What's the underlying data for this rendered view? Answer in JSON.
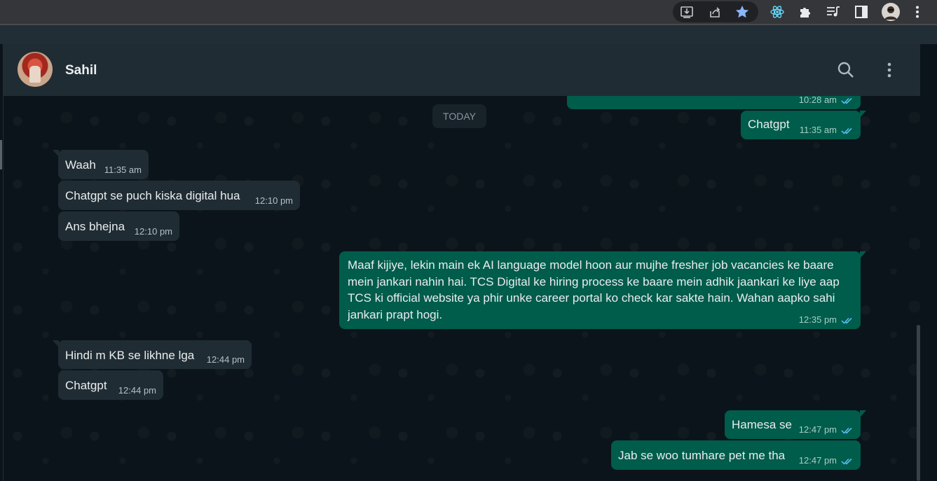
{
  "browser": {
    "icons": [
      "install-app-icon",
      "share-icon",
      "star-bookmark-icon",
      "react-devtools-icon",
      "extensions-puzzle-icon",
      "media-controls-icon",
      "side-panel-icon",
      "profile-avatar",
      "browser-menu-icon"
    ],
    "bookmark_star_color": "#8ab4f8"
  },
  "chat": {
    "contact_name": "Sahil",
    "header_icons": [
      "search-icon",
      "menu-icon"
    ],
    "date_divider": "TODAY",
    "colors": {
      "incoming_bubble": "#202c33",
      "outgoing_bubble": "#005c4b",
      "background": "#0b141a",
      "read_ticks": "#53bdeb"
    },
    "messages": [
      {
        "direction": "out",
        "text": "",
        "time": "10:28 am",
        "read": true
      },
      {
        "direction": "out",
        "text": "Chatgpt",
        "time": "11:35 am",
        "read": true
      },
      {
        "direction": "in",
        "text": "Waah",
        "time": "11:35 am"
      },
      {
        "direction": "in",
        "text": "Chatgpt se puch kiska digital hua",
        "time": "12:10 pm"
      },
      {
        "direction": "in",
        "text": "Ans bhejna",
        "time": "12:10 pm"
      },
      {
        "direction": "out",
        "text": "Maaf kijiye, lekin main ek AI language model hoon aur mujhe fresher job vacancies ke baare mein jankari nahin hai. TCS Digital ke hiring process ke baare mein adhik jaankari ke liye aap TCS ki official website ya phir unke career portal ko check kar sakte hain. Wahan aapko sahi jankari prapt hogi.",
        "time": "12:35 pm",
        "read": true
      },
      {
        "direction": "in",
        "text": "Hindi m KB se likhne lga",
        "time": "12:44 pm"
      },
      {
        "direction": "in",
        "text": "Chatgpt",
        "time": "12:44 pm"
      },
      {
        "direction": "out",
        "text": "Hamesa se",
        "time": "12:47 pm",
        "read": true
      },
      {
        "direction": "out",
        "text": "Jab se woo tumhare pet me tha",
        "time": "12:47 pm",
        "read": true
      }
    ]
  }
}
